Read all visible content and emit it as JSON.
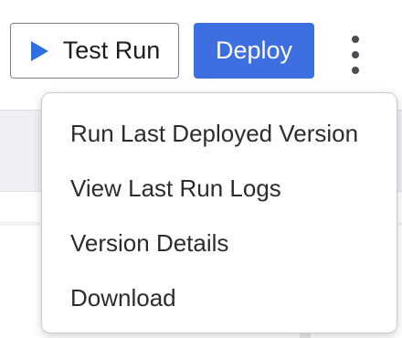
{
  "toolbar": {
    "test_run_label": "Test Run",
    "deploy_label": "Deploy",
    "more_icon": "more-vertical-icon",
    "play_icon": "play-icon"
  },
  "menu": {
    "items": [
      {
        "label": "Run Last Deployed Version"
      },
      {
        "label": "View Last Run Logs"
      },
      {
        "label": "Version Details"
      },
      {
        "label": "Download"
      }
    ]
  },
  "colors": {
    "accent": "#3d6fe0",
    "play": "#2f6fe4"
  }
}
